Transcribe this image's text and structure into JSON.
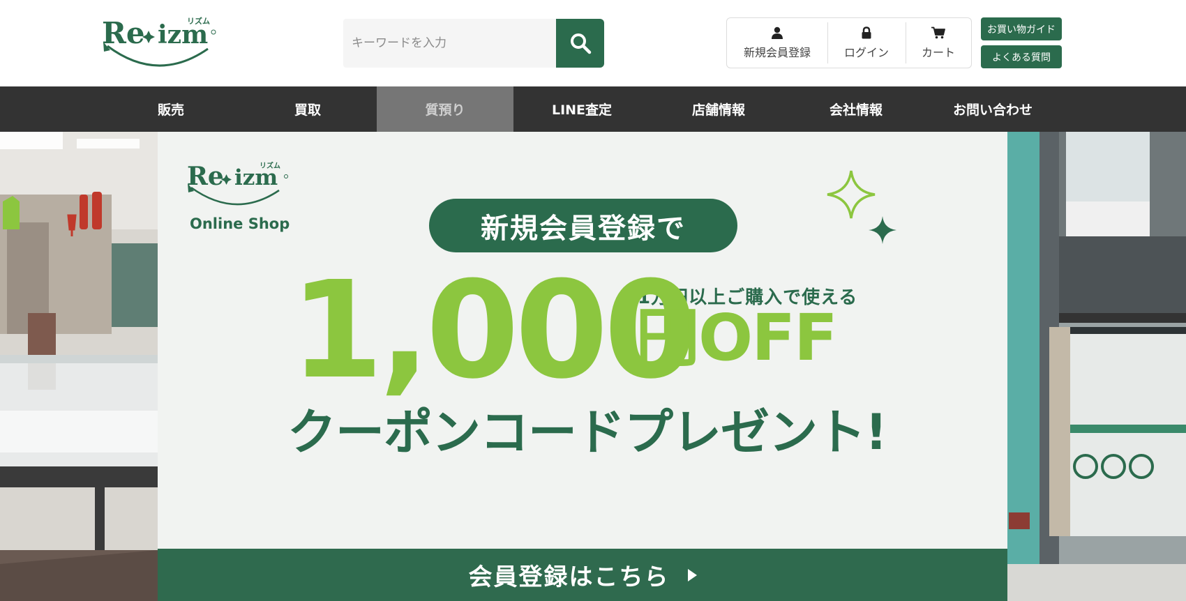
{
  "header": {
    "logo_text": "Re✦izm",
    "logo_kana": "リズム",
    "search": {
      "placeholder": "キーワードを入力"
    },
    "account": [
      {
        "label": "新規会員登録",
        "icon": "user-icon"
      },
      {
        "label": "ログイン",
        "icon": "lock-icon"
      },
      {
        "label": "カート",
        "icon": "cart-icon"
      }
    ],
    "guide_label": "お買い物ガイド",
    "faq_label": "よくある質問"
  },
  "nav": {
    "items": [
      "販売",
      "買取",
      "質預り",
      "LINE査定",
      "店舗情報",
      "会社情報",
      "お問い合わせ"
    ],
    "active_index": 2
  },
  "banner": {
    "logo_text": "Re✦izm",
    "logo_kana": "リズム",
    "online_shop": "Online Shop",
    "headline": "新規会員登録で",
    "condition": "1万円以上ご購入で使える",
    "amount": "1,000",
    "unit_off": "円OFF",
    "coupon_text": "クーポンコードプレゼント!",
    "cta_label": "会員登録はこちら"
  },
  "colors": {
    "brand_green": "#2b6b4d",
    "accent_lime": "#8cc63f",
    "nav_bg": "#333333",
    "nav_active_bg": "#767676"
  }
}
